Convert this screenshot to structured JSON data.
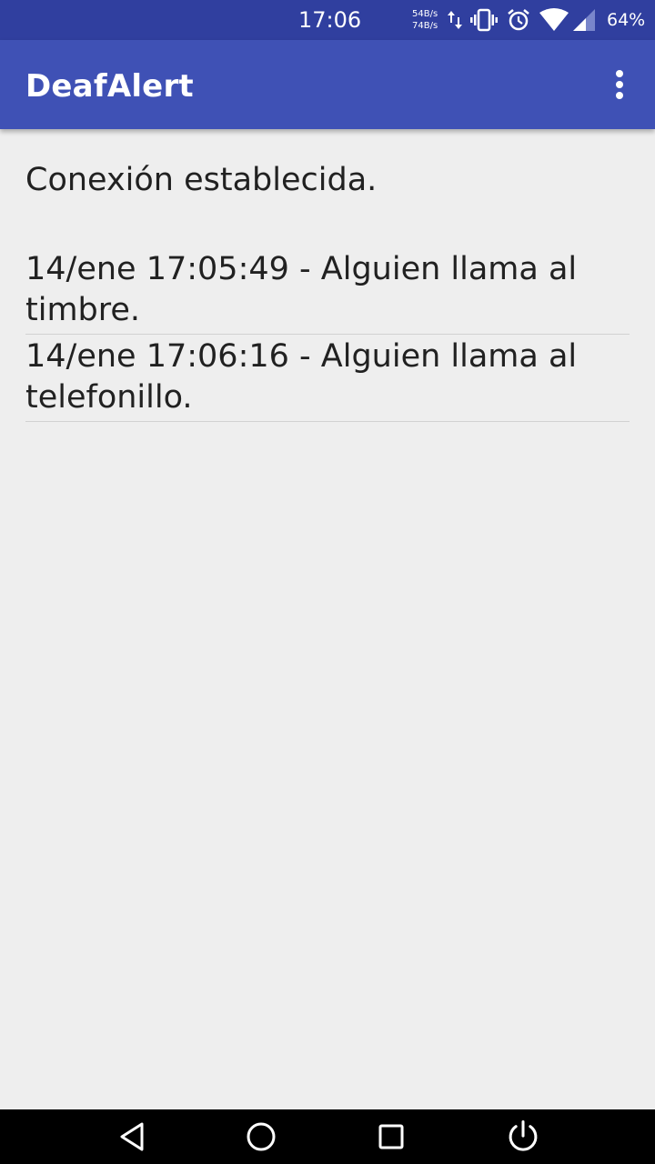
{
  "status_bar": {
    "time": "17:06",
    "upload_speed": "54B/s",
    "download_speed": "74B/s",
    "battery_percent": "64%",
    "icons": [
      "data-transfer-icon",
      "vibrate-icon",
      "alarm-icon",
      "wifi-icon",
      "signal-icon"
    ]
  },
  "app_bar": {
    "title": "DeafAlert",
    "menu_icon": "overflow-menu-icon"
  },
  "main": {
    "connection_status": "Conexión establecida.",
    "alerts": [
      "14/ene 17:05:49 - Alguien llama al timbre.",
      "14/ene 17:06:16 - Alguien llama al telefonillo."
    ]
  },
  "nav_bar": {
    "icons": [
      "back-icon",
      "home-icon",
      "recents-icon",
      "power-icon"
    ]
  },
  "colors": {
    "status_bar": "#303f9f",
    "app_bar": "#3f51b5",
    "background": "#eeeeee",
    "text": "#212121"
  }
}
